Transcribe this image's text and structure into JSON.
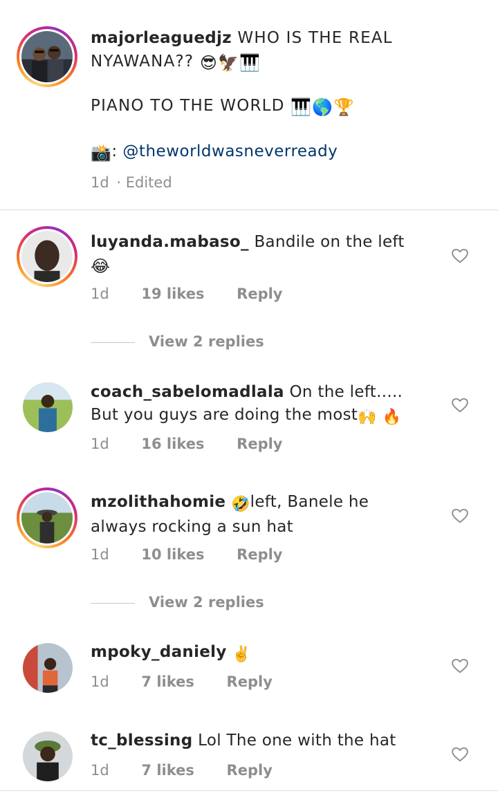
{
  "caption": {
    "username": "majorleaguedjz",
    "text_line1": "WHO IS THE REAL",
    "text_line2": "NYAWANA??",
    "text_line3": "PIANO TO THE WORLD",
    "camera_label": ":",
    "mention": "@theworldwasneverready",
    "time": "1d",
    "edited": "· Edited"
  },
  "comments": [
    {
      "username": "luyanda.mabaso_",
      "text": "Bandile on the left",
      "time": "1d",
      "likes": "19 likes",
      "reply": "Reply"
    },
    {
      "username": "coach_sabelomadlala",
      "text": "On the left.....",
      "text2": "But you guys are doing the most",
      "time": "1d",
      "likes": "16 likes",
      "reply": "Reply"
    },
    {
      "username": "mzolithahomie",
      "text": "left, Banele he",
      "text2": "always rocking a sun hat",
      "time": "1d",
      "likes": "10 likes",
      "reply": "Reply"
    },
    {
      "username": "mpoky_daniely",
      "text": "",
      "time": "1d",
      "likes": "7 likes",
      "reply": "Reply"
    },
    {
      "username": "tc_blessing",
      "text": "Lol The one with the hat",
      "time": "1d",
      "likes": "7 likes",
      "reply": "Reply"
    }
  ],
  "view_replies": [
    "View 2 replies",
    "View 2 replies"
  ],
  "icons": {
    "like": "heart-outline-icon",
    "emoji": [
      "sunglasses-emoji",
      "eagle-emoji",
      "piano-emoji",
      "globe-emoji",
      "trophy-emoji",
      "camera-flash-emoji",
      "joy-emoji",
      "raised-hands-emoji",
      "fire-emoji",
      "rofl-emoji",
      "victory-hand-emoji"
    ]
  },
  "colors": {
    "text": "#262626",
    "secondary": "#8e8e8e",
    "mention": "#00376b",
    "divider": "#dbdbdb"
  }
}
